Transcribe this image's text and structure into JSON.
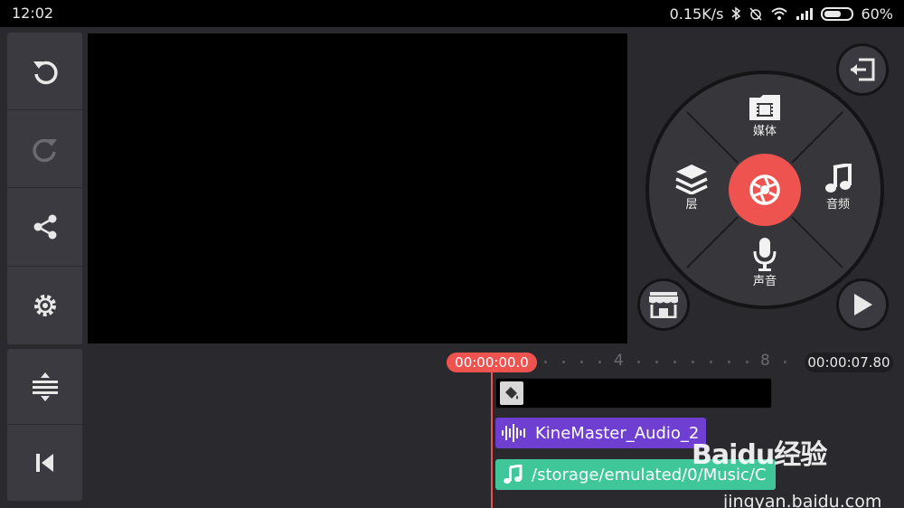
{
  "status_bar": {
    "time": "12:02",
    "speed": "0.15K/s",
    "battery": "60%"
  },
  "left_tools": [
    {
      "name": "undo",
      "icon": "undo-icon",
      "enabled": true
    },
    {
      "name": "redo",
      "icon": "redo-icon",
      "enabled": false
    },
    {
      "name": "share",
      "icon": "share-icon",
      "enabled": true
    },
    {
      "name": "settings",
      "icon": "gear-icon",
      "enabled": true
    }
  ],
  "left_bottom_tools": [
    {
      "name": "timeline-expand",
      "icon": "expand-vertical-icon"
    },
    {
      "name": "jump-to-start",
      "icon": "skip-to-start-icon"
    }
  ],
  "wheel": {
    "media_label": "媒体",
    "audio_label": "音频",
    "voice_label": "声音",
    "layer_label": "层"
  },
  "timeline": {
    "current_time": "00:00:00.0",
    "total_time": "00:00:07.80",
    "ruler_marks": [
      "4",
      "8"
    ],
    "audio_clip_label": "KineMaster_Audio_2",
    "music_clip_label": "/storage/emulated/0/Music/C"
  },
  "watermark": {
    "brand": "Baidu经验",
    "url": "jingyan.baidu.com"
  },
  "colors": {
    "accent": "#ef5350",
    "audio_clip": "#6f3fd2",
    "music_clip": "#3fc79a",
    "panel": "#3a3a40"
  }
}
